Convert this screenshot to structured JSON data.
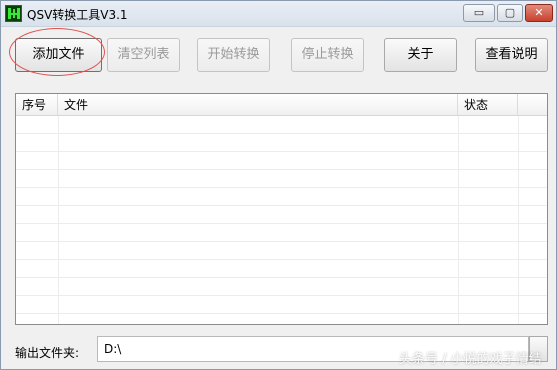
{
  "window": {
    "title": "QSV转换工具V3.1",
    "controls": {
      "minimize": "▭",
      "maximize": "▢",
      "close": "✕"
    }
  },
  "toolbar": {
    "add_files": "添加文件",
    "clear_list": "清空列表",
    "start_convert": "开始转换",
    "stop_convert": "停止转换",
    "about": "关于",
    "view_help": "查看说明"
  },
  "file_list": {
    "columns": [
      "序号",
      "文件",
      "状态"
    ],
    "rows": []
  },
  "output": {
    "label": "输出文件夹:",
    "path": "D:\\"
  },
  "watermark": "头条号 / 小悦的戏子情结",
  "colors": {
    "highlight": "#e0524d",
    "icon_bg": "#0b3d0b",
    "icon_fg": "#39e639",
    "close_button": "#c8412c"
  },
  "icons": {
    "app": "app-icon-green-matrix",
    "minimize": "minimize-icon",
    "maximize": "maximize-icon",
    "close": "close-icon"
  }
}
